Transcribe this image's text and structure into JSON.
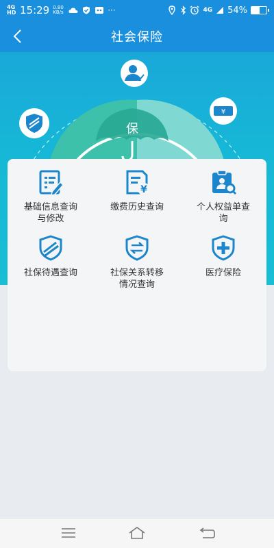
{
  "status_bar": {
    "signal": "4G HD",
    "time": "15:29",
    "speed_value": "0.80",
    "speed_unit": "KB/s",
    "more": "···",
    "network": "4G",
    "battery_text": "54%",
    "battery_level": 0.54
  },
  "header": {
    "title": "社会保险"
  },
  "hero": {
    "umbrella_char": "保"
  },
  "services": [
    {
      "label": "基础信息查询与修改",
      "icon": "document-edit-icon"
    },
    {
      "label": "缴费历史查询",
      "icon": "payment-document-icon"
    },
    {
      "label": "个人权益单查询",
      "icon": "clipboard-search-icon"
    },
    {
      "label": "社保待遇查询",
      "icon": "shield-icon"
    },
    {
      "label": "社保关系转移情况查询",
      "icon": "shield-transfer-icon"
    },
    {
      "label": "医疗保险",
      "icon": "shield-plus-icon"
    }
  ],
  "colors": {
    "primary": "#1a8fdd",
    "icon": "#1b86cc",
    "hero_teal": "#19bdd4",
    "umbrella_dark": "#3ec1ab",
    "umbrella_light": "#7fd8d1"
  }
}
